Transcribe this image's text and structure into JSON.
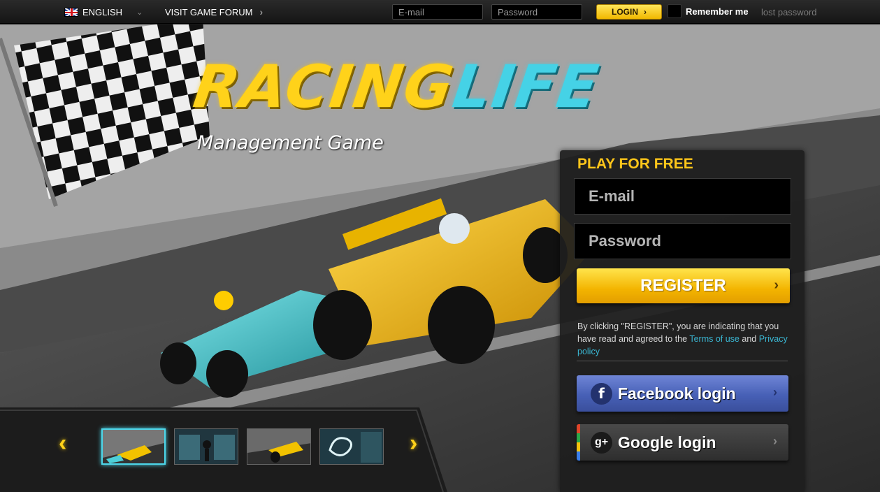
{
  "topbar": {
    "language": "ENGLISH",
    "forum_link": "VISIT GAME FORUM",
    "email_placeholder": "E-mail",
    "password_placeholder": "Password",
    "login_label": "LOGIN",
    "remember_label": "Remember me",
    "lost_password": "lost password"
  },
  "hero": {
    "logo_part1": "RACING",
    "logo_part2": "LIFE",
    "subtitle": "Management Game"
  },
  "register_panel": {
    "title": "PLAY FOR FREE",
    "email_placeholder": "E-mail",
    "password_placeholder": "Password",
    "register_label": "REGISTER",
    "terms_prefix": "By clicking \"REGISTER\", you are indicating that you have read and agreed to the",
    "terms_link": "Terms of use",
    "terms_and": "and",
    "privacy_link": "Privacy policy",
    "facebook_label": "Facebook login",
    "google_label": "Google login"
  },
  "carousel": {
    "thumbnails": [
      "screenshot-1",
      "screenshot-2",
      "screenshot-3",
      "screenshot-4"
    ],
    "active_index": 0
  },
  "colors": {
    "brand_yellow": "#ffd21a",
    "brand_cyan": "#45d2e6",
    "facebook_blue": "#4760b6"
  }
}
